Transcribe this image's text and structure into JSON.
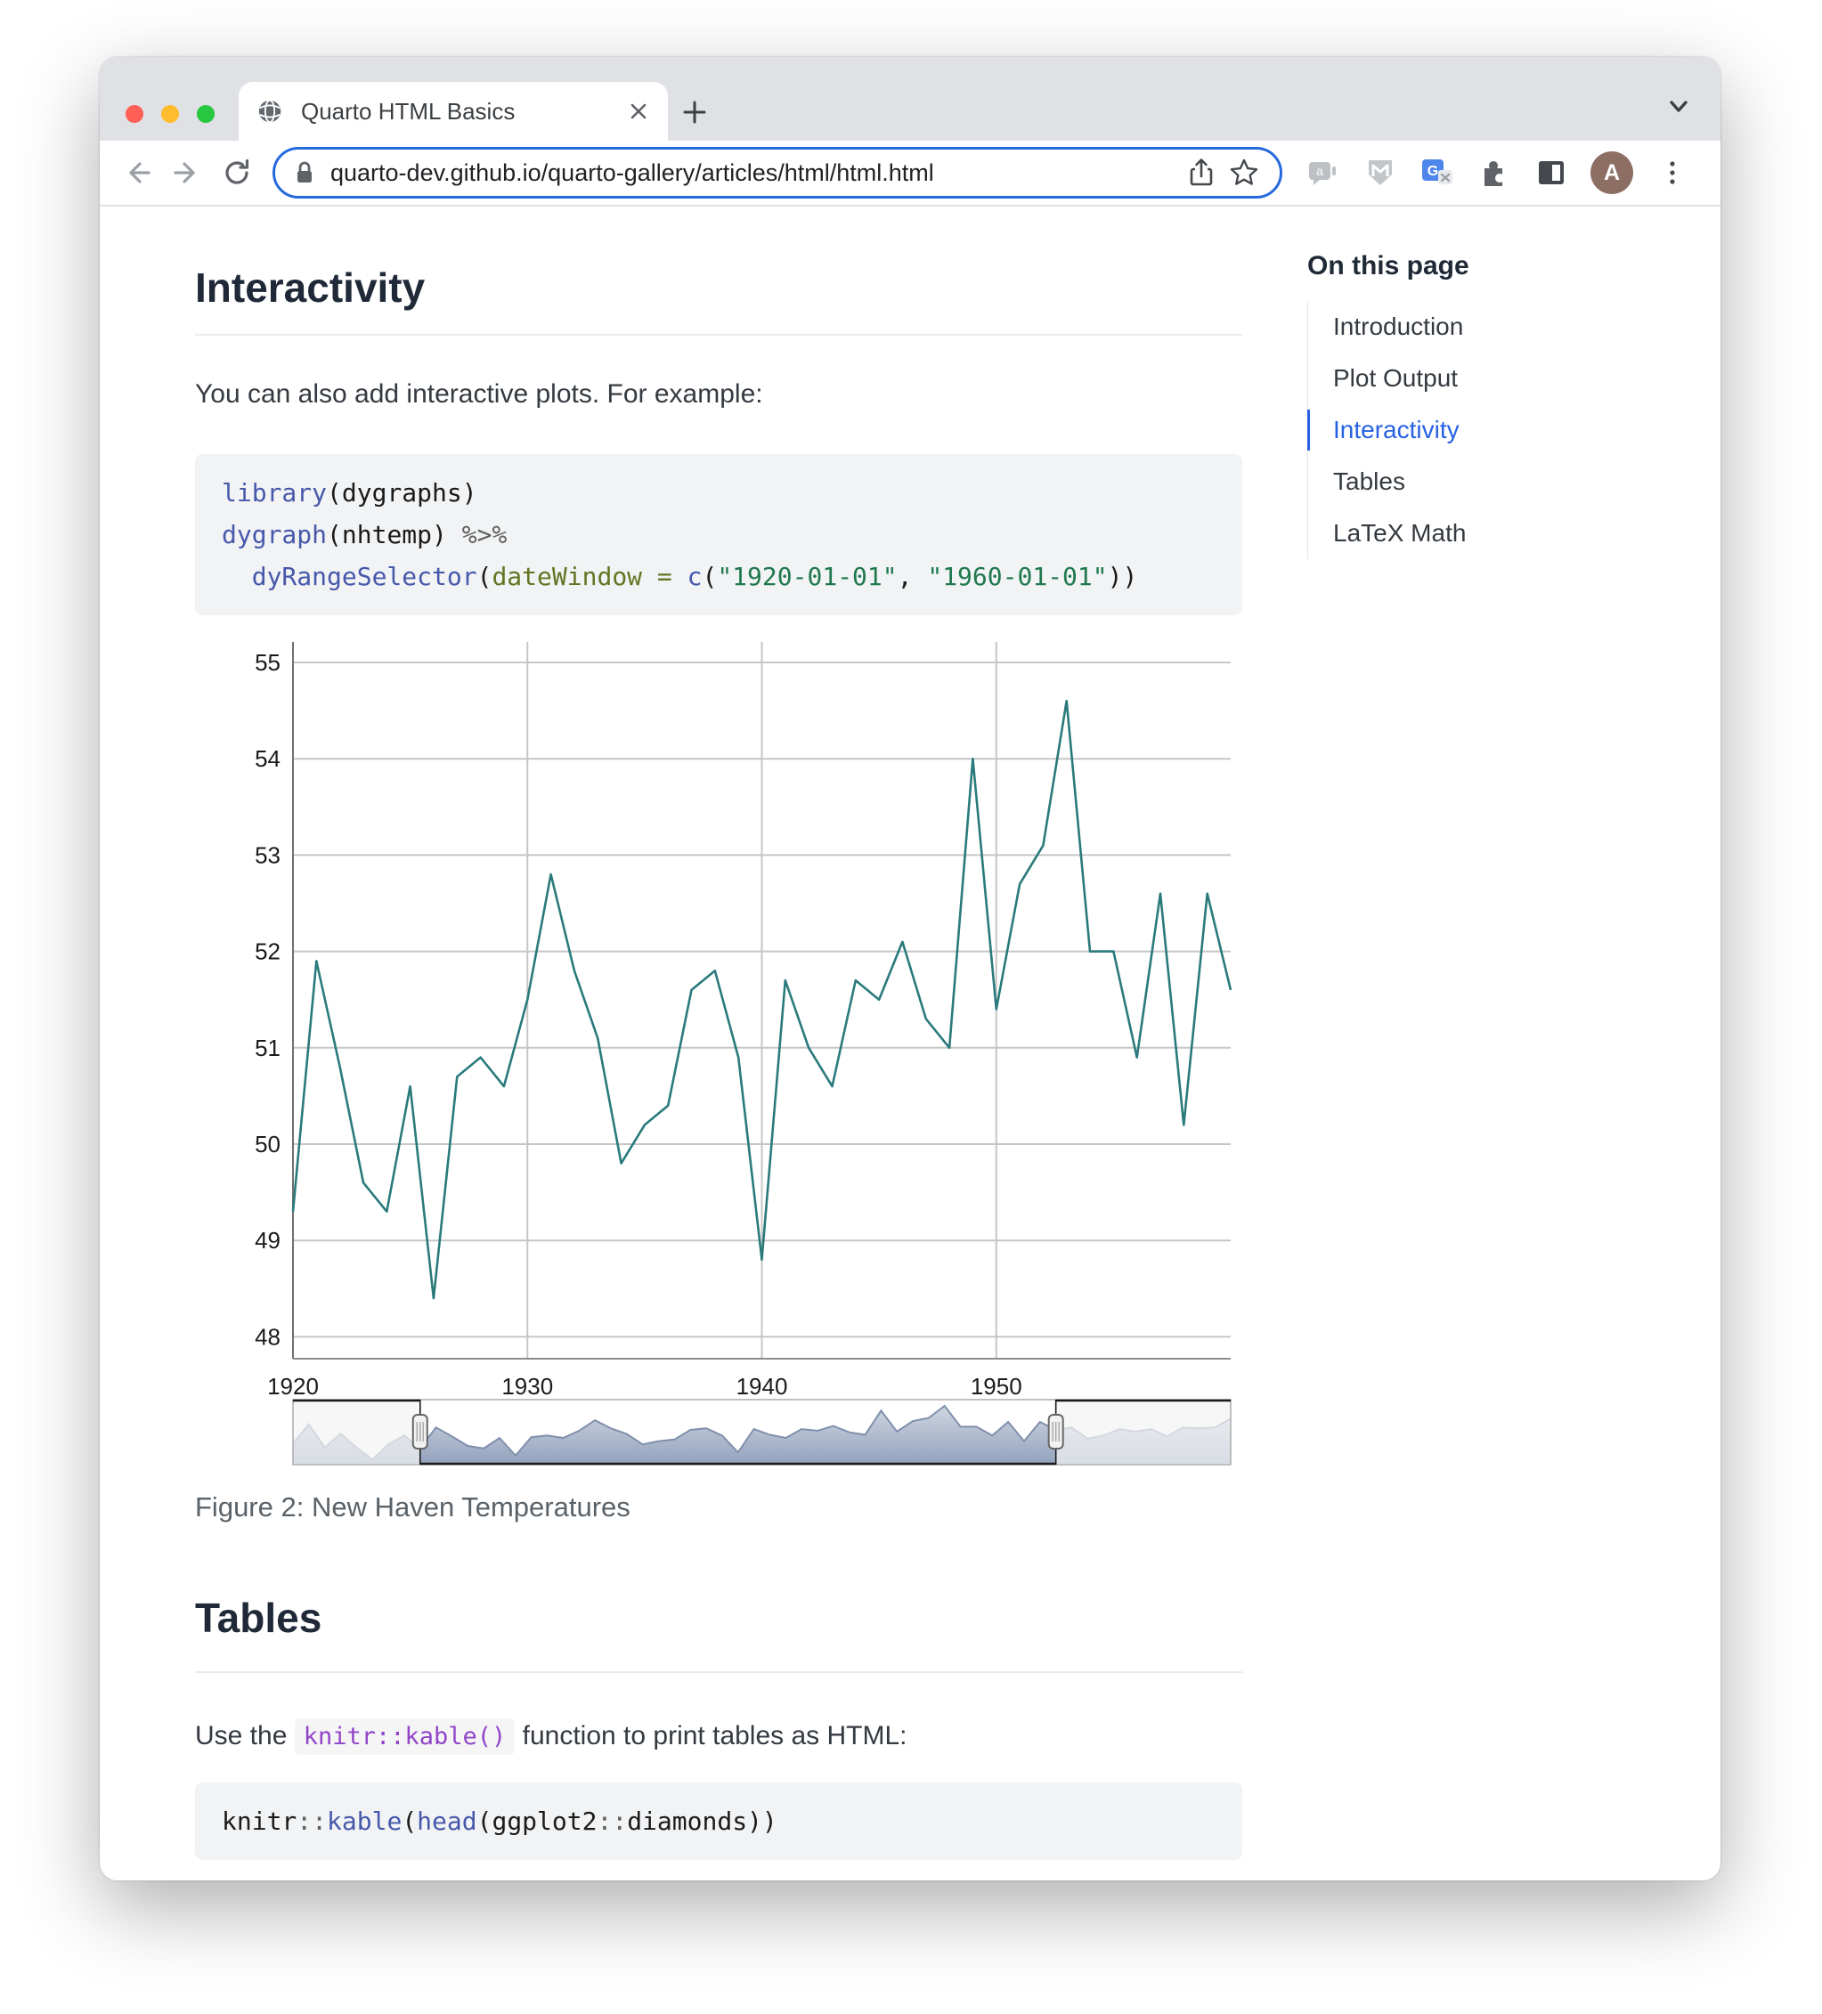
{
  "browser": {
    "tab_title": "Quarto HTML Basics",
    "new_tab_label": "+",
    "url": "quarto-dev.github.io/quarto-gallery/articles/html/html.html",
    "avatar_letter": "A",
    "traffic_lights": [
      "close",
      "minimize",
      "zoom"
    ]
  },
  "content": {
    "heading_interactivity": "Interactivity",
    "para_intro": "You can also add interactive plots. For example:",
    "figure_caption": "Figure 2: New Haven Temperatures",
    "heading_tables": "Tables",
    "para_kable_before": "Use the ",
    "para_kable_code": "knitr::kable()",
    "para_kable_after": " function to print tables as HTML:"
  },
  "toc": {
    "title": "On this page",
    "items": [
      {
        "label": "Introduction",
        "active": false
      },
      {
        "label": "Plot Output",
        "active": false
      },
      {
        "label": "Interactivity",
        "active": true
      },
      {
        "label": "Tables",
        "active": false
      },
      {
        "label": "LaTeX Math",
        "active": false
      }
    ]
  },
  "code_blocks": {
    "block1": [
      [
        {
          "t": "library",
          "c": "fu"
        },
        {
          "t": "(dygraphs)",
          "c": "pl"
        }
      ],
      [
        {
          "t": "dygraph",
          "c": "fu"
        },
        {
          "t": "(nhtemp) ",
          "c": "pl"
        },
        {
          "t": "%>%",
          "c": "op"
        }
      ],
      [
        {
          "t": "  ",
          "c": "pl"
        },
        {
          "t": "dyRangeSelector",
          "c": "fu"
        },
        {
          "t": "(",
          "c": "pl"
        },
        {
          "t": "dateWindow",
          "c": "at"
        },
        {
          "t": " ",
          "c": "pl"
        },
        {
          "t": "=",
          "c": "at"
        },
        {
          "t": " ",
          "c": "pl"
        },
        {
          "t": "c",
          "c": "fu"
        },
        {
          "t": "(",
          "c": "pl"
        },
        {
          "t": "\"1920-01-01\"",
          "c": "st"
        },
        {
          "t": ", ",
          "c": "pl"
        },
        {
          "t": "\"1960-01-01\"",
          "c": "st"
        },
        {
          "t": "))",
          "c": "pl"
        }
      ]
    ],
    "block2": [
      [
        {
          "t": "knitr",
          "c": "pl"
        },
        {
          "t": "::",
          "c": "op"
        },
        {
          "t": "kable",
          "c": "fu"
        },
        {
          "t": "(",
          "c": "pl"
        },
        {
          "t": "head",
          "c": "fu"
        },
        {
          "t": "(ggplot2",
          "c": "pl"
        },
        {
          "t": "::",
          "c": "op"
        },
        {
          "t": "diamonds))",
          "c": "pl"
        }
      ]
    ]
  },
  "colors": {
    "accent_blue": "#2761e3",
    "omnibox_focus": "#2569de",
    "inline_code_purple": "#9145c8",
    "code_function": "#4758AB",
    "code_string": "#20794D",
    "code_attribute": "#657422",
    "code_operator": "#5E5E5E",
    "traffic_red": "#ff5f57",
    "traffic_yellow": "#febc2e",
    "traffic_green": "#28c840"
  },
  "chart_data": [
    {
      "type": "line",
      "title": "New Haven Temperatures (dygraph, visible window)",
      "series_name": "nhtemp",
      "x_range": [
        1920,
        1960
      ],
      "x_step": 1,
      "values": [
        49.3,
        51.9,
        50.8,
        49.6,
        49.3,
        50.6,
        48.4,
        50.7,
        50.9,
        50.6,
        51.5,
        52.8,
        51.8,
        51.1,
        49.8,
        50.2,
        50.4,
        51.6,
        51.8,
        50.9,
        48.8,
        51.7,
        51.0,
        50.6,
        51.7,
        51.5,
        52.1,
        51.3,
        51.0,
        54.0,
        51.4,
        52.7,
        53.1,
        54.6,
        52.0,
        52.0,
        50.9,
        52.6,
        50.2,
        52.6,
        51.6
      ],
      "xticks": [
        1920,
        1930,
        1940,
        1950
      ],
      "yticks": [
        48,
        49,
        50,
        51,
        52,
        53,
        54,
        55
      ],
      "ylim": [
        47.75,
        55.2
      ],
      "grid": true,
      "legend": "none",
      "line_color": "#2a7a7c",
      "grid_color": "#c6c6c6",
      "axis_color": "#7a7a7a"
    },
    {
      "type": "area",
      "role": "range-selector",
      "title": "Full nhtemp series shown in dygraphs range selector",
      "x_range": [
        1912,
        1971
      ],
      "x_step": 1,
      "values": [
        49.9,
        52.3,
        49.4,
        51.1,
        49.4,
        47.9,
        49.8,
        50.9,
        49.3,
        51.9,
        50.8,
        49.6,
        49.3,
        50.6,
        48.4,
        50.7,
        50.9,
        50.6,
        51.5,
        52.8,
        51.8,
        51.1,
        49.8,
        50.2,
        50.4,
        51.6,
        51.8,
        50.9,
        48.8,
        51.7,
        51.0,
        50.6,
        51.7,
        51.5,
        52.1,
        51.3,
        51.0,
        54.0,
        51.4,
        52.7,
        53.1,
        54.6,
        52.0,
        52.0,
        50.9,
        52.6,
        50.2,
        52.6,
        51.6,
        51.9,
        50.5,
        50.9,
        51.7,
        51.4,
        51.7,
        50.8,
        51.9,
        51.8,
        51.9,
        53.0
      ],
      "window": [
        1920,
        1960
      ],
      "stroke": "#808FAB",
      "fill_top": "#cfd6e1",
      "fill_bottom": "#93a2bd",
      "veil": "rgba(244,244,244,0.72)"
    }
  ]
}
